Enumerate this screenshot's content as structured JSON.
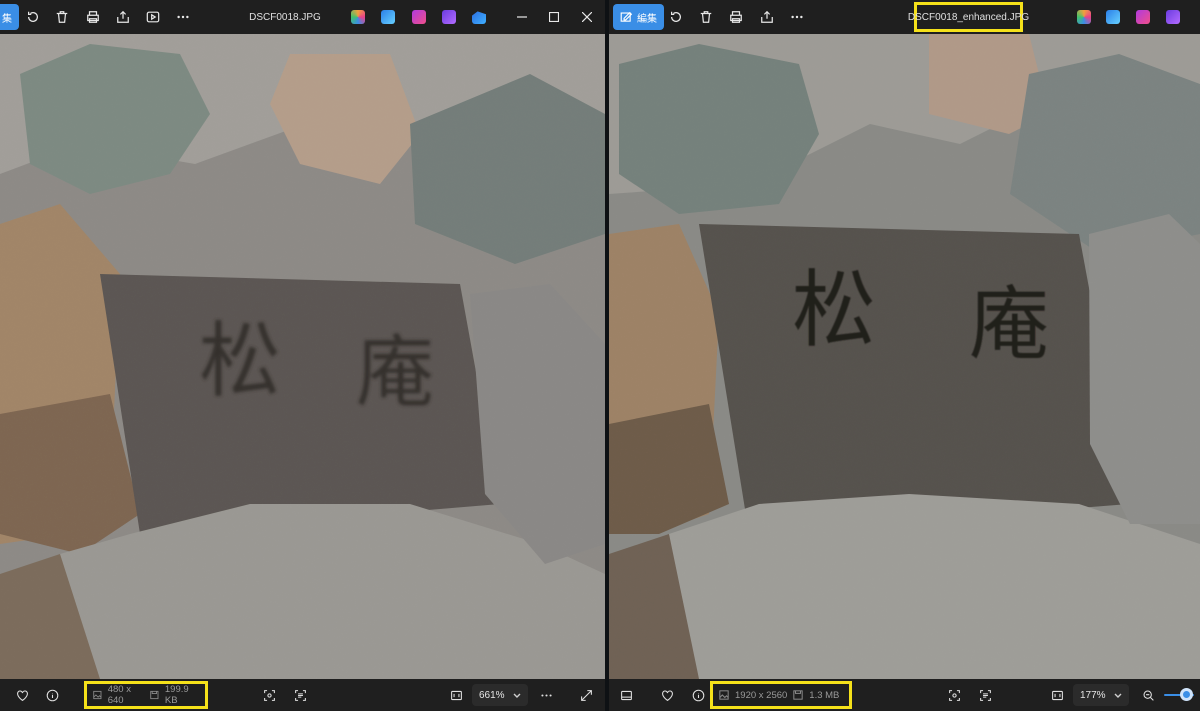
{
  "left_viewer": {
    "edit_label": "集",
    "filename": "DSCF0018.JPG",
    "dimensions": "480 x 640",
    "filesize": "199.9 KB",
    "zoom": "661%"
  },
  "right_viewer": {
    "edit_label": "編集",
    "filename": "DSCF0018_enhanced.JPG",
    "dimensions": "1920 x 2560",
    "filesize": "1.3 MB",
    "zoom": "177%"
  },
  "photo": {
    "kanji_left": "松",
    "kanji_right": "庵"
  },
  "colors": {
    "accent": "#3a8ee6",
    "highlight": "#f5e11a",
    "toolbar_bg": "#1f1f1f"
  },
  "icons": [
    "edit-icon",
    "rotate-icon",
    "trash-icon",
    "print-icon",
    "share-icon",
    "slideshow-icon",
    "more-icon",
    "minimize-icon",
    "maximize-icon",
    "close-icon",
    "heart-icon",
    "info-icon",
    "image-icon",
    "save-icon",
    "visual-search-icon",
    "text-scan-icon",
    "fit-screen-icon",
    "chevron-down-icon",
    "fullscreen-icon",
    "filmstrip-icon",
    "zoom-out-icon"
  ]
}
